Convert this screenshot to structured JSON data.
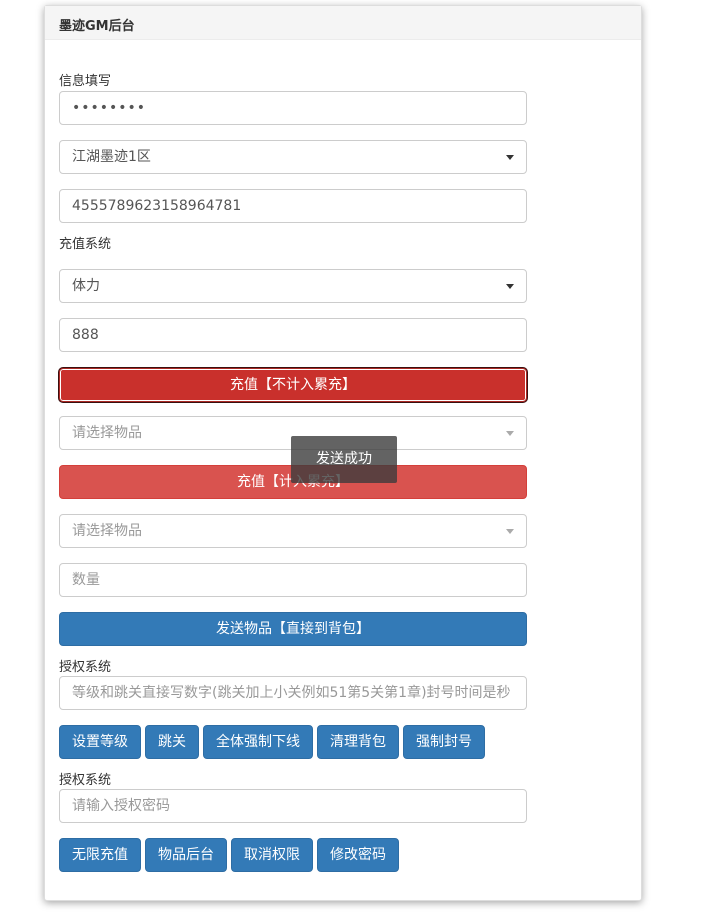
{
  "header": {
    "title": "墨迹GM后台"
  },
  "info": {
    "section_label": "信息填写",
    "password_value": "••••••••",
    "server_select": "江湖墨迹1区",
    "account_id": "4555789623158964781"
  },
  "recharge": {
    "section_label": "充值系统",
    "type_select": "体力",
    "amount": "888",
    "btn_not_cumulative": "充值【不计入累充】",
    "item_select_1_placeholder": "请选择物品",
    "btn_cumulative": "充值【计入累充】",
    "item_select_2_placeholder": "请选择物品",
    "quantity_placeholder": "数量",
    "btn_send_item": "发送物品【直接到背包】"
  },
  "toast": {
    "message": "发送成功"
  },
  "auth1": {
    "section_label": "授权系统",
    "input_placeholder": "等级和跳关直接写数字(跳关加上小关例如51第5关第1章)封号时间是秒",
    "buttons": [
      "设置等级",
      "跳关",
      "全体强制下线",
      "清理背包",
      "强制封号"
    ]
  },
  "auth2": {
    "section_label": "授权系统",
    "input_placeholder": "请输入授权密码",
    "buttons": [
      "无限充值",
      "物品后台",
      "取消权限",
      "修改密码"
    ]
  },
  "colors": {
    "primary": "#337ab7",
    "danger": "#d9534f",
    "danger_active": "#c9302c"
  }
}
